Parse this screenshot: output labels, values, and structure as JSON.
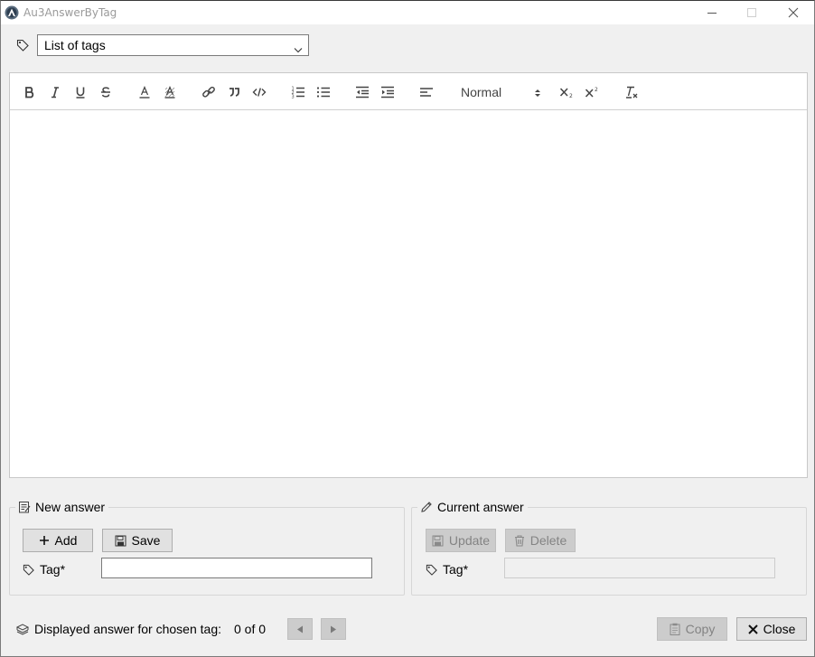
{
  "window": {
    "title": "Au3AnswerByTag",
    "icons": {
      "app": "autoit-icon",
      "minimize": "minimize-icon",
      "maximize": "maximize-icon",
      "close": "close-icon"
    }
  },
  "tag_selector": {
    "selected": "List of tags",
    "icon": "tag-icon"
  },
  "editor": {
    "toolbar": {
      "header_select": "Normal",
      "buttons": [
        "bold",
        "italic",
        "underline",
        "strike",
        "font-color",
        "background-color",
        "link",
        "blockquote",
        "code-block",
        "ordered-list",
        "bullet-list",
        "outdent",
        "indent",
        "align",
        "header",
        "subscript",
        "superscript",
        "clean"
      ]
    },
    "content": ""
  },
  "new_answer": {
    "legend": "New answer",
    "add_label": "Add",
    "save_label": "Save",
    "tag_label": "Tag*",
    "tag_value": ""
  },
  "current_answer": {
    "legend": "Current answer",
    "update_label": "Update",
    "delete_label": "Delete",
    "tag_label": "Tag*",
    "tag_value": ""
  },
  "footer": {
    "displayed_label": "Displayed answer for chosen tag:",
    "counter": "0 of 0",
    "copy_label": "Copy",
    "close_label": "Close"
  },
  "colors": {
    "window_bg": "#f0f0f0",
    "disabled_button": "#cccccc",
    "button": "#e1e1e1",
    "border": "#7a7a7a"
  }
}
